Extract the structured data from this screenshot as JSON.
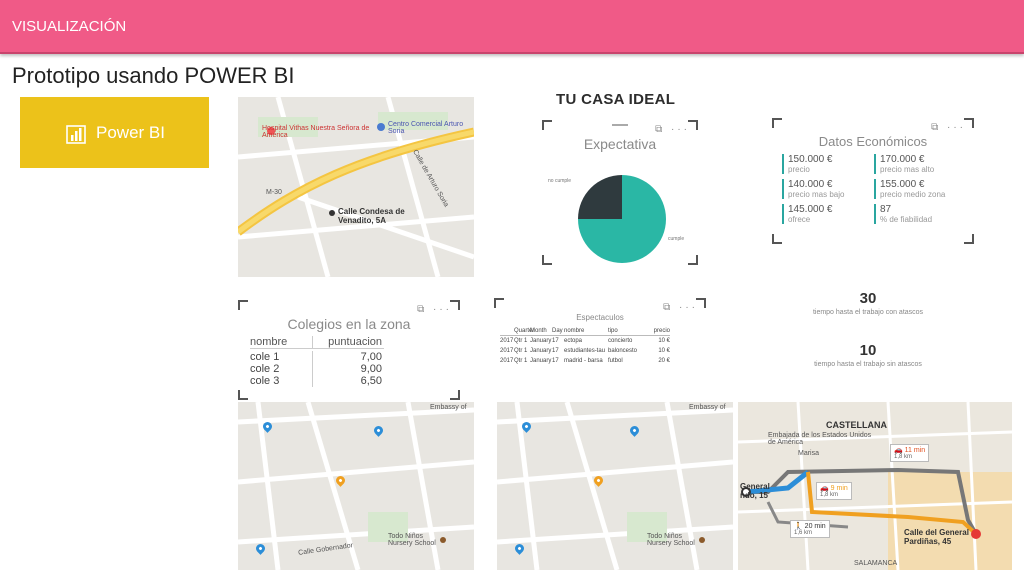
{
  "header": {
    "title": "VISUALIZACIÓN"
  },
  "subtitle": "Prototipo usando POWER BI",
  "powerbi_tile": {
    "label": "Power BI",
    "icon": "powerbi-icon"
  },
  "dashboard_title": "TU CASA IDEAL",
  "map1": {
    "labels": [
      "Hospital Vithas Nuestra Señora de América",
      "Centro Comercial Arturo Soria",
      "Calle Condesa de Venadito, 5A",
      "Calle de Arturo Soria",
      "M-30"
    ]
  },
  "expectativa": {
    "title": "Expectativa",
    "legend": [
      "no cumple",
      "cumple"
    ]
  },
  "datos_economicos": {
    "title": "Datos Económicos",
    "items": [
      {
        "value": "150.000 €",
        "label": "precio"
      },
      {
        "value": "170.000 €",
        "label": "precio mas alto"
      },
      {
        "value": "140.000 €",
        "label": "precio mas bajo"
      },
      {
        "value": "155.000 €",
        "label": "precio medio zona"
      },
      {
        "value": "145.000 €",
        "label": "ofrece"
      },
      {
        "value": "87",
        "label": "% de fiabilidad"
      }
    ]
  },
  "colegios": {
    "title": "Colegios en la zona",
    "headers": [
      "nombre",
      "puntuacion"
    ],
    "rows": [
      [
        "cole 1",
        "7,00"
      ],
      [
        "cole 2",
        "9,00"
      ],
      [
        "cole 3",
        "6,50"
      ]
    ]
  },
  "espectaculos": {
    "title": "Espectaculos",
    "headers": [
      "",
      "Quarter",
      "Month",
      "Day",
      "nombre",
      "tipo",
      "precio"
    ],
    "rows": [
      [
        "2017",
        "Qtr 1",
        "January",
        "17",
        "ectopa",
        "concierto",
        "10 €"
      ],
      [
        "2017",
        "Qtr 1",
        "January",
        "17",
        "estudiantes-tau",
        "baloncesto",
        "10 €"
      ],
      [
        "2017",
        "Qtr 1",
        "January",
        "17",
        "madrid - barsa",
        "futbol",
        "20 €"
      ]
    ]
  },
  "kpis": [
    {
      "value": "30",
      "label": "tiempo hasta el trabajo con atascos"
    },
    {
      "value": "10",
      "label": "tiempo hasta el trabajo sin atascos"
    }
  ],
  "map2": {
    "labels": [
      "Embassy of",
      "Todo Niños Nursery School",
      "Calle Gobernador"
    ]
  },
  "map3": {
    "labels": [
      "Embassy of",
      "Todo Niños Nursery School"
    ]
  },
  "map4": {
    "labels": [
      "CASTELLANA",
      "Embajada de los Estados Unidos de América",
      "Marisa",
      "General ndo, 15",
      "Calle del General Pardiñas, 45",
      "SALAMANCA"
    ],
    "routes": [
      {
        "time": "11 min",
        "dist": "1,8 km"
      },
      {
        "time": "9 min",
        "dist": "1,8 km"
      },
      {
        "time": "20 min",
        "dist": "1,6 km"
      }
    ]
  },
  "colors": {
    "header": "#f05a87",
    "tile": "#ecc21a",
    "teal": "#2ab7a5",
    "dark": "#2f3a3e"
  }
}
